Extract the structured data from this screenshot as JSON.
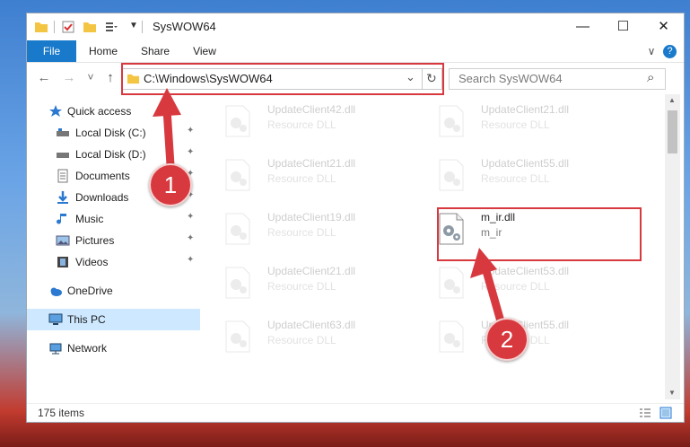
{
  "window": {
    "title": "SysWOW64",
    "controls": {
      "minimize": "—",
      "maximize": "☐",
      "close": "✕"
    }
  },
  "ribbon": {
    "tabs": [
      "File",
      "Home",
      "Share",
      "View"
    ],
    "expand": "∨",
    "help": "?"
  },
  "navigation": {
    "back": "←",
    "forward": "→",
    "recent": "˅",
    "up": "↑",
    "address": "C:\\Windows\\SysWOW64",
    "address_dropdown": "⌄",
    "refresh": "↻",
    "search_placeholder": "Search SysWOW64",
    "search_icon_glyph": "⌕"
  },
  "nav_pane": {
    "quick_access": "Quick access",
    "items": [
      {
        "label": "Local Disk (C:)",
        "pinned": true
      },
      {
        "label": "Local Disk (D:)",
        "pinned": true
      },
      {
        "label": "Documents",
        "pinned": true
      },
      {
        "label": "Downloads",
        "pinned": true
      },
      {
        "label": "Music",
        "pinned": true
      },
      {
        "label": "Pictures",
        "pinned": true
      },
      {
        "label": "Videos",
        "pinned": true
      }
    ],
    "pin_glyph": "📌",
    "onedrive": "OneDrive",
    "this_pc": "This PC",
    "network": "Network"
  },
  "files": [
    {
      "name": "UpdateClient42.dll",
      "desc": "Resource DLL",
      "faded": true
    },
    {
      "name": "UpdateClient21.dll",
      "desc": "Resource DLL",
      "faded": true
    },
    {
      "name": "UpdateClient21.dll",
      "desc": "Resource DLL",
      "faded": true
    },
    {
      "name": "UpdateClient55.dll",
      "desc": "Resource DLL",
      "faded": true
    },
    {
      "name": "UpdateClient19.dll",
      "desc": "Resource DLL",
      "faded": true
    },
    {
      "name": "m_ir.dll",
      "desc": "m_ir",
      "faded": false
    },
    {
      "name": "UpdateClient21.dll",
      "desc": "Resource DLL",
      "faded": true
    },
    {
      "name": "UpdateClient53.dll",
      "desc": "Resource DLL",
      "faded": true
    },
    {
      "name": "UpdateClient63.dll",
      "desc": "Resource DLL",
      "faded": true
    },
    {
      "name": "UpdateClient55.dll",
      "desc": "Resource DLL",
      "faded": true
    }
  ],
  "status": {
    "item_count": "175 items"
  },
  "annotations": {
    "step1": "1",
    "step2": "2"
  },
  "colors": {
    "accent": "#1979ca",
    "annotation": "#d7393f",
    "selected": "#cde8ff"
  }
}
